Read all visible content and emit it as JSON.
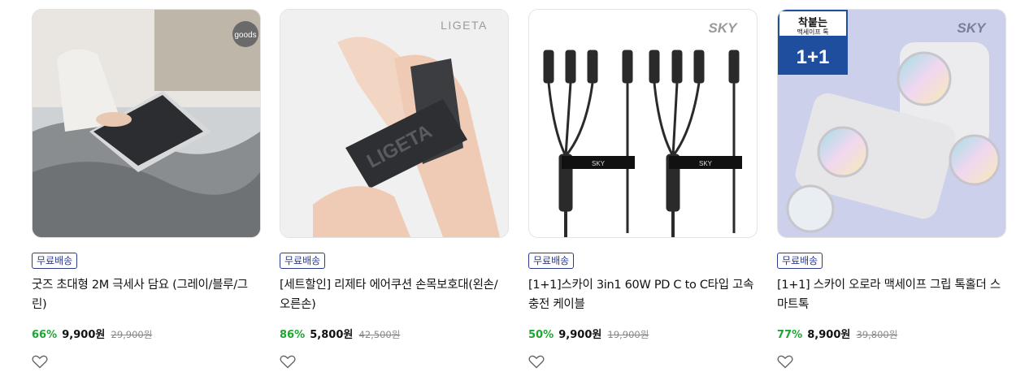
{
  "products": [
    {
      "badge": "무료배송",
      "title": "굿즈 초대형 2M 극세사 담요 (그레이/블루/그린)",
      "discount": "66%",
      "price": "9,900원",
      "original_price": "29,900원",
      "image_brand": "goods",
      "image": "person-with-tablet-on-gray-blanket"
    },
    {
      "badge": "무료배송",
      "title": "[세트할인] 리제타 에어쿠션 손목보호대(왼손/오른손)",
      "discount": "86%",
      "price": "5,800원",
      "original_price": "42,500원",
      "image_brand": "LIGETA",
      "image_strap_text": "LIGETA",
      "image": "wrist-support-brace"
    },
    {
      "badge": "무료배송",
      "title": "[1+1]스카이 3in1 60W PD C to C타입 고속충전 케이블",
      "discount": "50%",
      "price": "9,900원",
      "original_price": "19,900원",
      "image_brand": "SKY",
      "image_cable_label": "SKY",
      "image": "multi-charging-cables"
    },
    {
      "badge": "무료배송",
      "title": "[1+1] 스카이 오로라 맥세이프 그립 톡홀더 스마트톡",
      "discount": "77%",
      "price": "8,900원",
      "original_price": "39,800원",
      "image_brand": "SKY",
      "image_promo_top": "착붙는",
      "image_promo_mid": "맥세이프 톡",
      "image_promo_big": "1+1",
      "image": "aurora-magsafe-grip-holders"
    }
  ],
  "colors": {
    "badge_border": "#2b3a8f",
    "discount": "#1ea533",
    "original_price": "#888888"
  },
  "icons": {
    "wishlist": "heart-outline-icon"
  }
}
